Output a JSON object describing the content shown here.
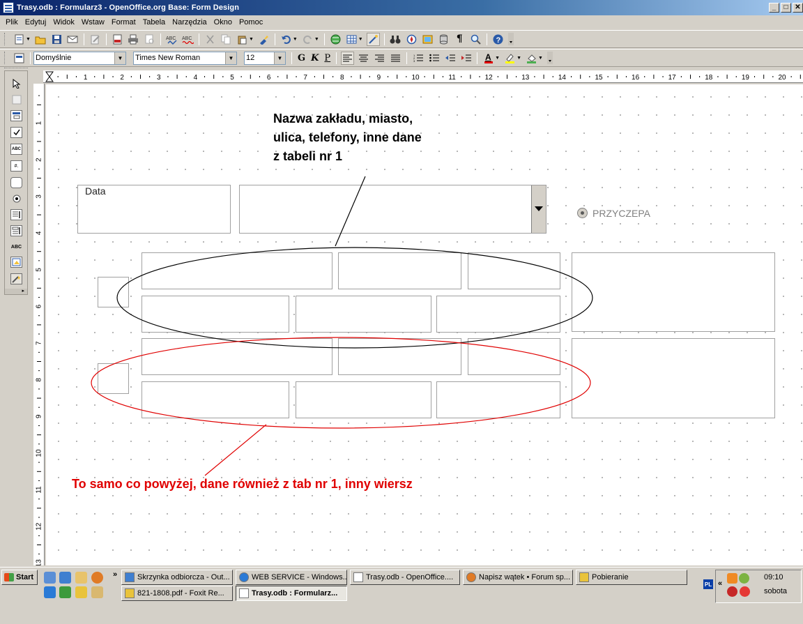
{
  "window": {
    "title": "Trasy.odb : Formularz3 - OpenOffice.org Base: Form Design",
    "controls": [
      "_",
      "□",
      "✕"
    ]
  },
  "menu": [
    "Plik",
    "Edytuj",
    "Widok",
    "Wstaw",
    "Format",
    "Tabela",
    "Narzędzia",
    "Okno",
    "Pomoc"
  ],
  "format_toolbar": {
    "style": "Domyślnie",
    "font": "Times New Roman",
    "size": "12",
    "bold": "G",
    "italic": "K",
    "underline": "P"
  },
  "ruler": {
    "h_numbers": [
      "1",
      "2",
      "3",
      "4",
      "5",
      "6",
      "7",
      "8",
      "9",
      "10",
      "11",
      "12",
      "13",
      "14",
      "15",
      "16",
      "17",
      "18",
      "19",
      "20"
    ],
    "v_numbers": [
      "1",
      "2",
      "3",
      "4",
      "5",
      "6",
      "7",
      "8",
      "9",
      "10",
      "11",
      "12",
      "13"
    ]
  },
  "form": {
    "date_label": "Data",
    "radio_label": "PRZYCZEPA",
    "annotation_black": [
      "Nazwa zakładu, miasto,",
      "ulica, telefony, inne dane",
      "z tabeli nr 1"
    ],
    "annotation_red": "To samo co powyżej, dane również z tab nr 1, inny wiersz",
    "colors": {
      "black_ellipse": "#000000",
      "red_ellipse": "#e00000"
    }
  },
  "taskbar": {
    "start": "Start",
    "tasks_row1": [
      "Skrzynka odbiorcza - Out...",
      "WEB SERVICE - Windows...",
      "Trasy.odb - OpenOffice....",
      "Napisz wątek • Forum sp...",
      "Pobieranie"
    ],
    "tasks_row2": [
      "821-1808.pdf - Foxit Re...",
      "Trasy.odb : Formularz..."
    ],
    "lang": "PL",
    "time": "09:10",
    "day": "sobota"
  }
}
